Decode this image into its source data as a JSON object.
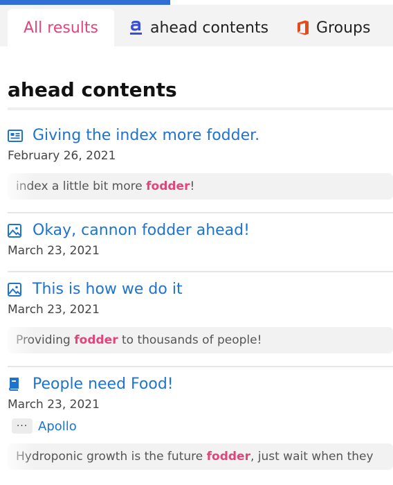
{
  "tabs": [
    {
      "label": "All results",
      "icon": "none",
      "active": true
    },
    {
      "label": "ahead contents",
      "icon": "ahead-logo-icon",
      "active": false
    },
    {
      "label": "Groups",
      "icon": "office-icon",
      "active": false
    }
  ],
  "section": {
    "title": "ahead contents"
  },
  "results": [
    {
      "title": "Giving the index more fodder.",
      "icon": "news-icon",
      "date": "February 26, 2021",
      "snippet": {
        "before": "index a little bit more ",
        "highlight": "fodder",
        "after": "!"
      }
    },
    {
      "title": "Okay, cannon fodder ahead!",
      "icon": "image-icon",
      "date": "March 23, 2021"
    },
    {
      "title": "This is how we do it",
      "icon": "image-icon",
      "date": "March 23, 2021",
      "snippet": {
        "before": "Providing ",
        "highlight": "fodder",
        "after": " to thousands of people!"
      }
    },
    {
      "title": "People need Food!",
      "icon": "book-icon",
      "date": "March 23, 2021",
      "group": {
        "more": "···",
        "name": "Apollo"
      },
      "snippet": {
        "before": "Hydroponic growth is the future ",
        "highlight": "fodder",
        "after": ", just wait when they"
      }
    }
  ],
  "colors": {
    "accent": "#e0457b",
    "link": "#1e73cf",
    "topbar": "#2f6fd6",
    "office": "#e64a19"
  }
}
